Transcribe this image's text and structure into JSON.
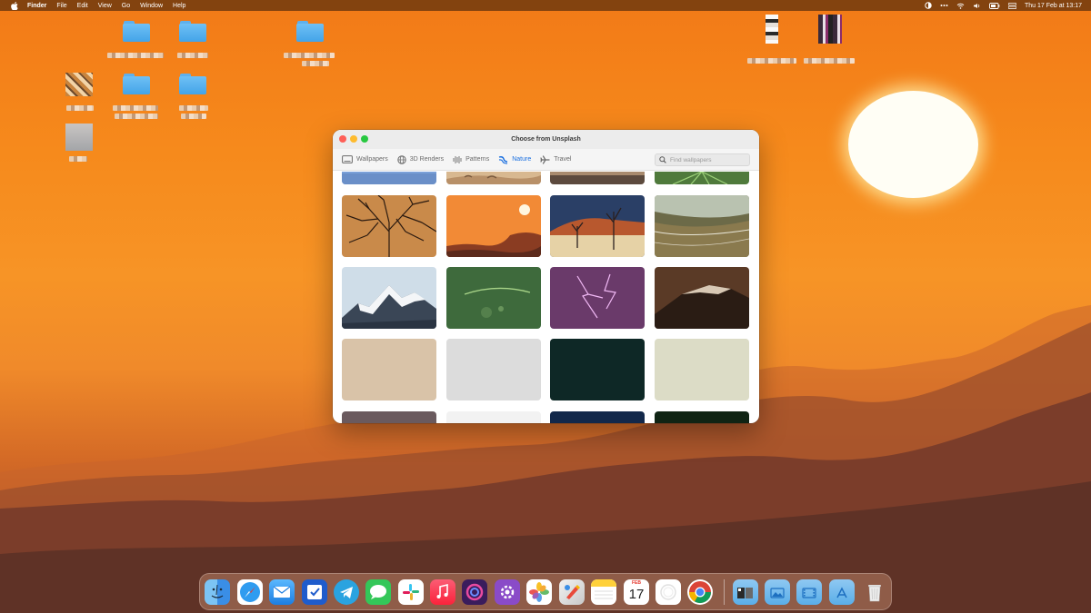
{
  "menubar": {
    "apple_icon": "apple-logo-icon",
    "app_name": "Finder",
    "menus": [
      "File",
      "Edit",
      "View",
      "Go",
      "Window",
      "Help"
    ],
    "clock": "Thu 17 Feb at  13:17",
    "status_icons": [
      "privacy-icon",
      "more-icon",
      "wifi-icon",
      "volume-icon",
      "battery-icon",
      "control-center-icon"
    ]
  },
  "window": {
    "title": "Choose from Unsplash",
    "tabs": [
      {
        "label": "Wallpapers",
        "icon": "monitor-icon"
      },
      {
        "label": "3D Renders",
        "icon": "globe-icon"
      },
      {
        "label": "Patterns",
        "icon": "waveform-icon"
      },
      {
        "label": "Nature",
        "icon": "wave-icon"
      },
      {
        "label": "Travel",
        "icon": "airplane-icon"
      }
    ],
    "active_tab": "Nature",
    "search": {
      "placeholder": "Find wallpapers",
      "value": ""
    }
  },
  "colors": {
    "accent": "#1a6fe0",
    "swatch_beige": "#d9c3a8",
    "swatch_light_gray": "#dcdcdc",
    "swatch_dark_teal": "#0e2826",
    "swatch_pale_sage": "#dcdcc6"
  },
  "dock": {
    "apps": [
      "finder-icon",
      "safari-icon",
      "mail-icon",
      "tasks-icon",
      "telegram-icon",
      "messages-icon",
      "slack-icon",
      "music-icon",
      "arc-icon",
      "app-store-settings-icon",
      "photos-icon",
      "pixelmator-icon",
      "notes-icon",
      "calendar-icon",
      "reminders-icon",
      "chrome-icon"
    ],
    "calendar": {
      "month": "FEB",
      "day": "17"
    },
    "folders": [
      "stack-folder-icon",
      "pictures-folder-icon",
      "movies-folder-icon",
      "applications-folder-icon",
      "trash-icon"
    ]
  }
}
